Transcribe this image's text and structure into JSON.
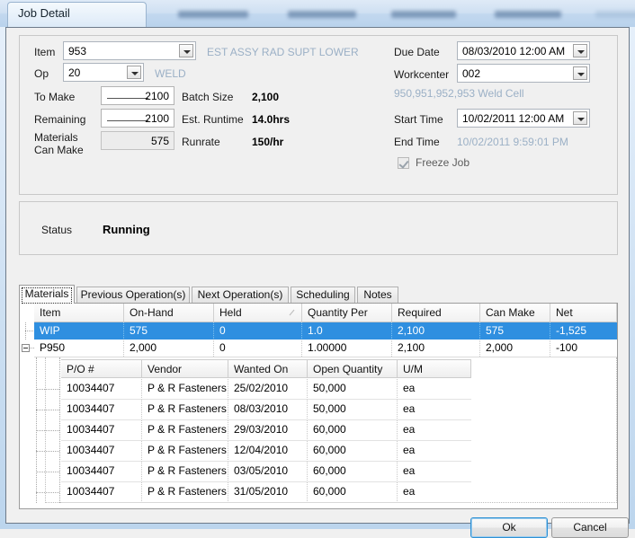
{
  "window": {
    "title": "Job Detail",
    "background_tabs": [
      "",
      "",
      "",
      "",
      "",
      ""
    ]
  },
  "form": {
    "item": {
      "label": "Item",
      "value": "953",
      "description": "EST ASSY RAD SUPT LOWER"
    },
    "op": {
      "label": "Op",
      "value": "20",
      "description": "WELD"
    },
    "to_make": {
      "label": "To Make",
      "value": "2100"
    },
    "remaining": {
      "label": "Remaining",
      "value": "2100"
    },
    "materials_can_make": {
      "label_line1": "Materials",
      "label_line2": "Can Make",
      "value": "575"
    },
    "batch_size": {
      "label": "Batch Size",
      "value": "2,100"
    },
    "est_runtime": {
      "label": "Est. Runtime",
      "value": "14.0hrs"
    },
    "runrate": {
      "label": "Runrate",
      "value": "150/hr"
    },
    "due_date": {
      "label": "Due Date",
      "value": "08/03/2010 12:00 AM"
    },
    "workcenter": {
      "label": "Workcenter",
      "value": "002",
      "description": "950,951,952,953 Weld Cell"
    },
    "start_time": {
      "label": "Start Time",
      "value": "10/02/2011 12:00 AM"
    },
    "end_time": {
      "label": "End Time",
      "value": "10/02/2011 9:59:01 PM"
    },
    "freeze_job": {
      "label": "Freeze Job",
      "checked": true
    }
  },
  "status": {
    "label": "Status",
    "value": "Running"
  },
  "tabs": [
    {
      "label": "Materials",
      "selected": true
    },
    {
      "label": "Previous Operation(s)",
      "selected": false
    },
    {
      "label": "Next Operation(s)",
      "selected": false
    },
    {
      "label": "Scheduling",
      "selected": false
    },
    {
      "label": "Notes",
      "selected": false
    }
  ],
  "materials_grid": {
    "columns": [
      "Item",
      "On-Hand",
      "Held",
      "Quantity Per",
      "Required",
      "Can Make",
      "Net"
    ],
    "sorted_column": "Held",
    "rows": [
      {
        "cells": [
          "WIP",
          "575",
          "0",
          "1.0",
          "2,100",
          "575",
          "-1,525"
        ],
        "selected": true,
        "expandable": false
      },
      {
        "cells": [
          "P950",
          "2,000",
          "0",
          "1.00000",
          "2,100",
          "2,000",
          "-100"
        ],
        "selected": false,
        "expandable": true
      }
    ]
  },
  "po_grid": {
    "columns": [
      "P/O #",
      "Vendor",
      "Wanted On",
      "Open Quantity",
      "U/M"
    ],
    "rows": [
      [
        "10034407",
        "P & R Fasteners",
        "25/02/2010",
        "50,000",
        "ea"
      ],
      [
        "10034407",
        "P & R Fasteners",
        "08/03/2010",
        "50,000",
        "ea"
      ],
      [
        "10034407",
        "P & R Fasteners",
        "29/03/2010",
        "60,000",
        "ea"
      ],
      [
        "10034407",
        "P & R Fasteners",
        "12/04/2010",
        "60,000",
        "ea"
      ],
      [
        "10034407",
        "P & R Fasteners",
        "03/05/2010",
        "60,000",
        "ea"
      ],
      [
        "10034407",
        "P & R Fasteners",
        "31/05/2010",
        "60,000",
        "ea"
      ]
    ]
  },
  "footer": {
    "ok": "Ok",
    "cancel": "Cancel"
  },
  "colors": {
    "selection": "#2f8fe0",
    "muted_text": "#9bb0c6",
    "accent_border": "#2e91d4"
  }
}
